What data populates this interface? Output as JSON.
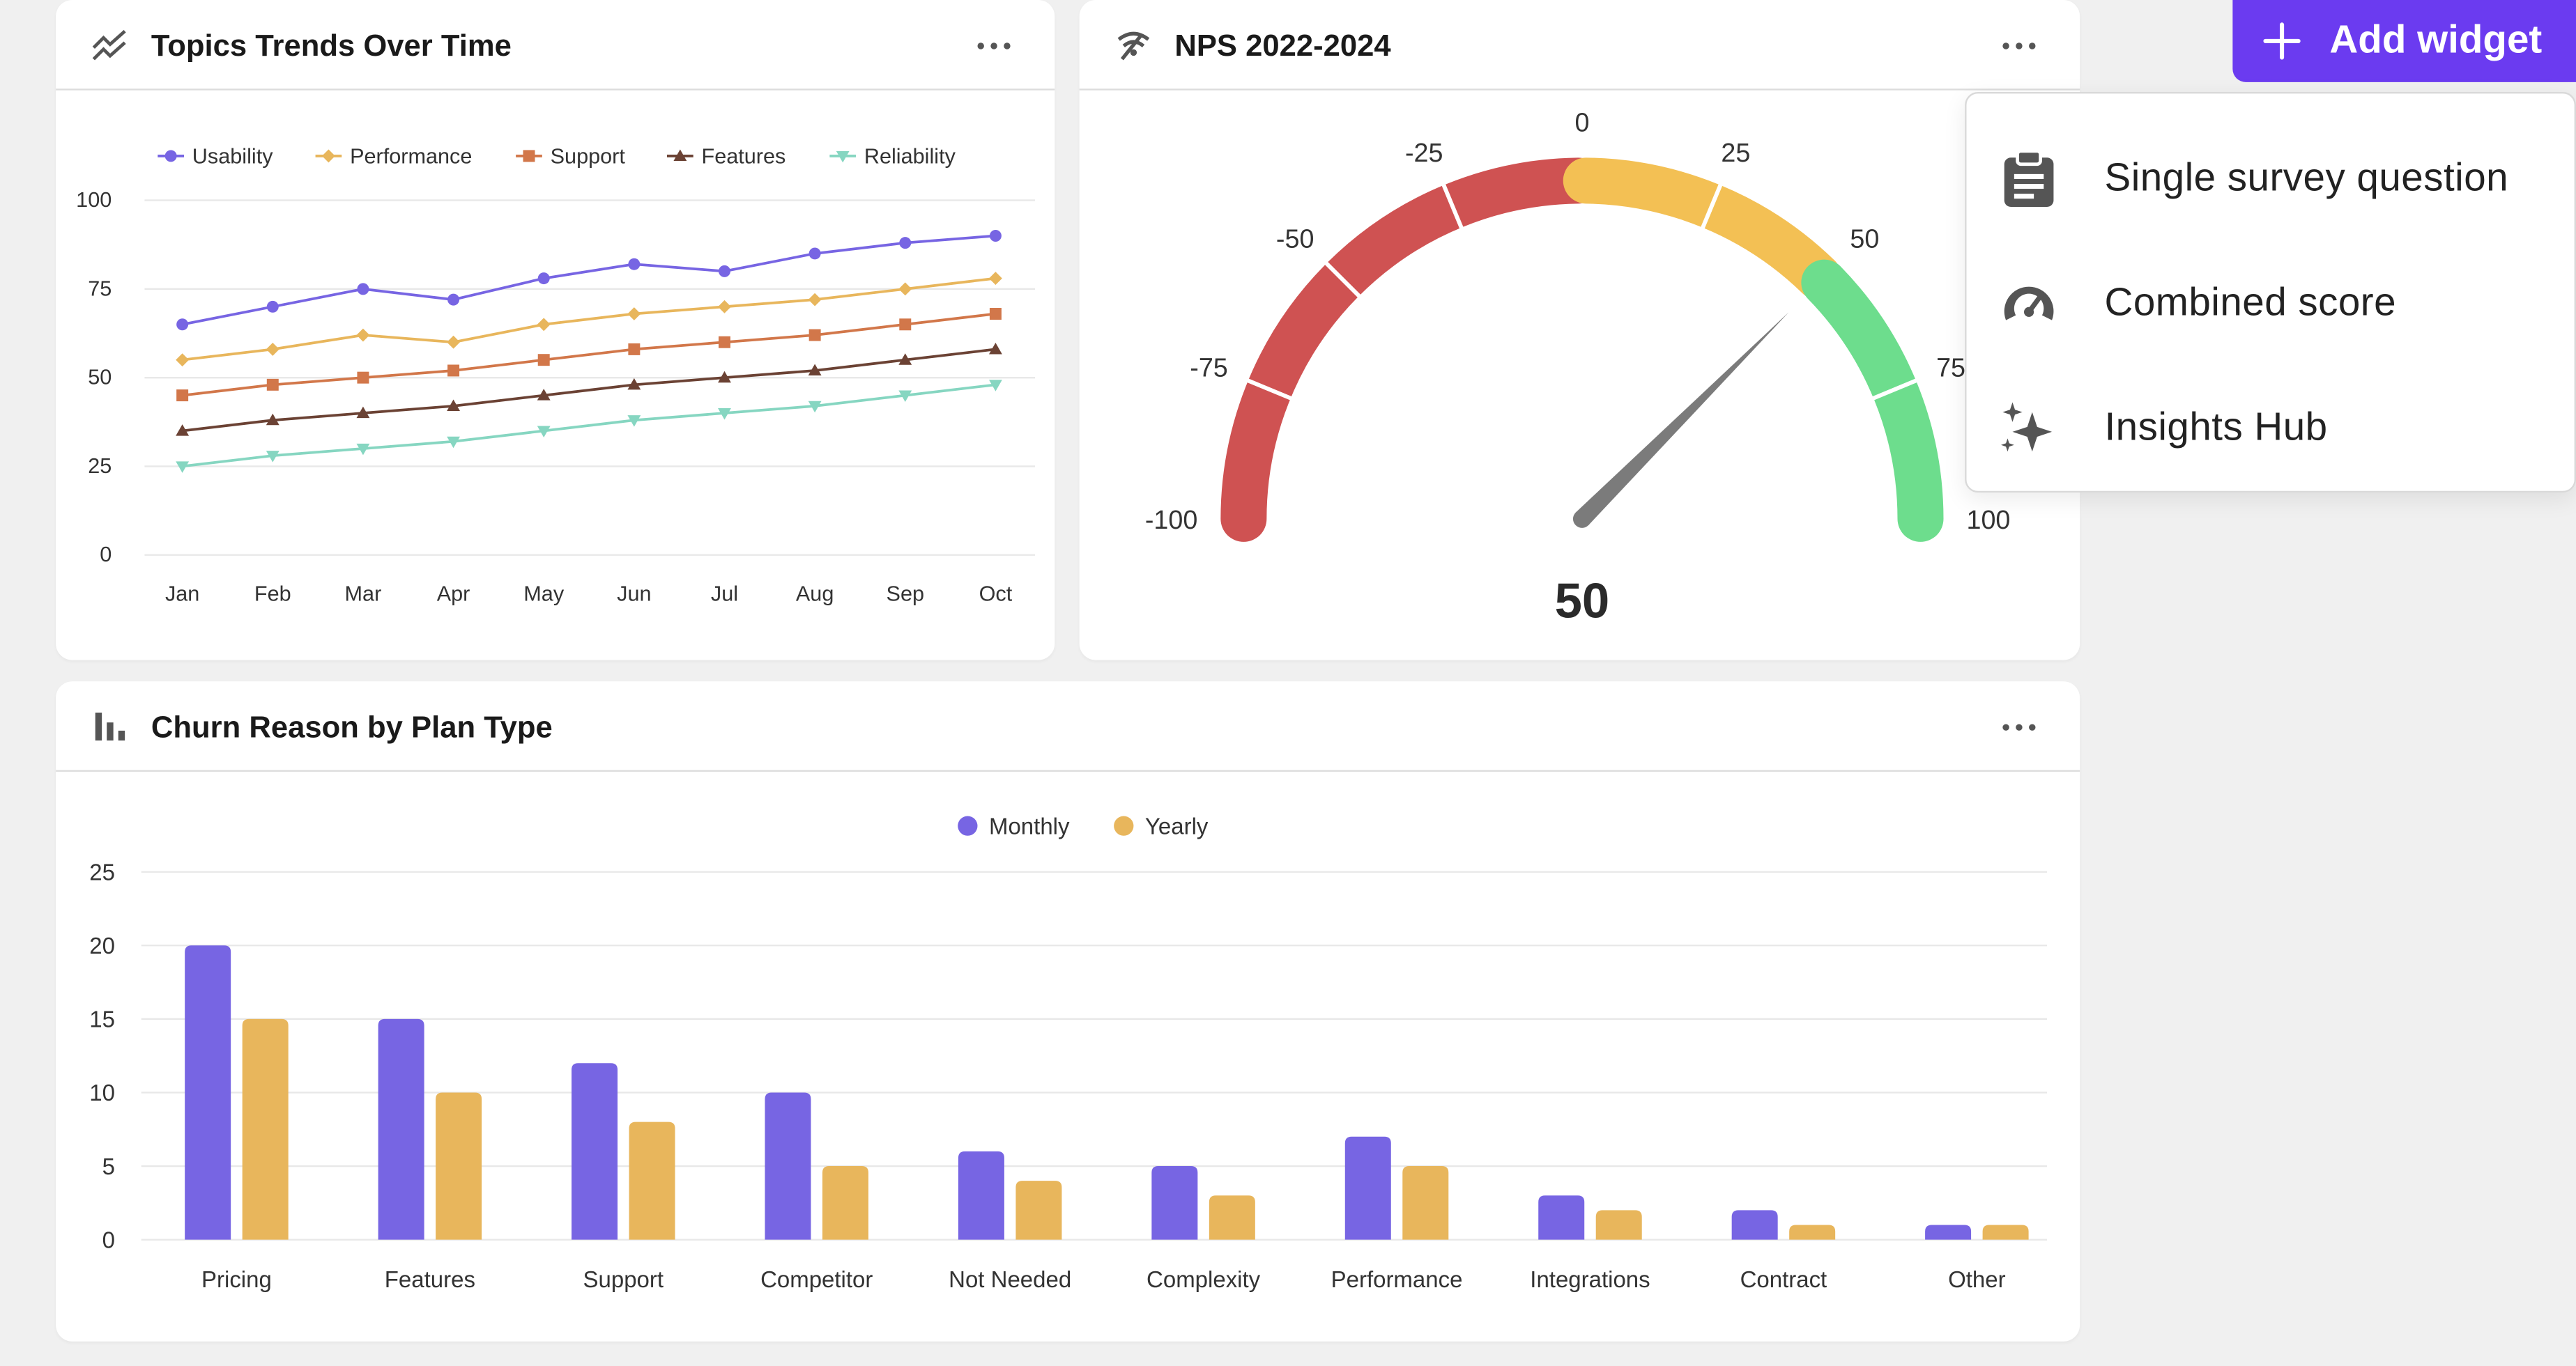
{
  "header_action": {
    "add_widget_label": "Add widget"
  },
  "add_menu": {
    "items": [
      {
        "label": "Single survey question",
        "icon": "clipboard-icon"
      },
      {
        "label": "Combined score",
        "icon": "gauge-icon"
      },
      {
        "label": "Insights Hub",
        "icon": "sparkles-icon"
      }
    ]
  },
  "widgets": {
    "topics": {
      "title": "Topics Trends Over Time",
      "icon": "trend-lines-icon"
    },
    "nps": {
      "title": "NPS 2022-2024",
      "icon": "signal-icon"
    },
    "churn": {
      "title": "Churn Reason by Plan Type",
      "icon": "bar-chart-icon"
    }
  },
  "colors": {
    "accent": "#6b3bf0",
    "red": "#cf5252",
    "yellow": "#f3c054",
    "green": "#6ddd8d",
    "monthly": "#7765e3",
    "yearly": "#e8b65c"
  },
  "chart_data": [
    {
      "type": "line",
      "title": "Topics Trends Over Time",
      "x": [
        "Jan",
        "Feb",
        "Mar",
        "Apr",
        "May",
        "Jun",
        "Jul",
        "Aug",
        "Sep",
        "Oct"
      ],
      "ylim": [
        0,
        100
      ],
      "yticks": [
        0,
        25,
        50,
        75,
        100
      ],
      "grid": true,
      "legend_position": "top",
      "series": [
        {
          "name": "Usability",
          "color": "#7765e3",
          "marker": "circle",
          "values": [
            65,
            70,
            75,
            72,
            78,
            82,
            80,
            85,
            88,
            90
          ]
        },
        {
          "name": "Performance",
          "color": "#e8b65c",
          "marker": "diamond",
          "values": [
            55,
            58,
            62,
            60,
            65,
            68,
            70,
            72,
            75,
            78
          ]
        },
        {
          "name": "Support",
          "color": "#d2774a",
          "marker": "square",
          "values": [
            45,
            48,
            50,
            52,
            55,
            58,
            60,
            62,
            65,
            68
          ]
        },
        {
          "name": "Features",
          "color": "#6b4234",
          "marker": "triangle-up",
          "values": [
            35,
            38,
            40,
            42,
            45,
            48,
            50,
            52,
            55,
            58
          ]
        },
        {
          "name": "Reliability",
          "color": "#86d6c1",
          "marker": "triangle-down",
          "values": [
            25,
            28,
            30,
            32,
            35,
            38,
            40,
            42,
            45,
            48
          ]
        }
      ]
    },
    {
      "type": "gauge",
      "title": "NPS 2022-2024",
      "value": 50,
      "value_label": "50",
      "range": [
        -100,
        100
      ],
      "tick_labels": [
        "-100",
        "-75",
        "-50",
        "-25",
        "0",
        "25",
        "50",
        "75",
        "100"
      ],
      "bands": [
        {
          "from": -100,
          "to": 0,
          "color": "#cf5252"
        },
        {
          "from": 0,
          "to": 50,
          "color": "#f3c054"
        },
        {
          "from": 50,
          "to": 100,
          "color": "#6ddd8d"
        }
      ]
    },
    {
      "type": "bar",
      "title": "Churn Reason by Plan Type",
      "categories": [
        "Pricing",
        "Features",
        "Support",
        "Competitor",
        "Not Needed",
        "Complexity",
        "Performance",
        "Integrations",
        "Contract",
        "Other"
      ],
      "ylim": [
        0,
        25
      ],
      "yticks": [
        0,
        5,
        10,
        15,
        20,
        25
      ],
      "grid": true,
      "legend_position": "top",
      "series": [
        {
          "name": "Monthly",
          "color": "#7765e3",
          "values": [
            20,
            15,
            12,
            10,
            6,
            5,
            7,
            3,
            2,
            1
          ]
        },
        {
          "name": "Yearly",
          "color": "#e8b65c",
          "values": [
            15,
            10,
            8,
            5,
            4,
            3,
            5,
            2,
            1,
            1
          ]
        }
      ]
    }
  ]
}
